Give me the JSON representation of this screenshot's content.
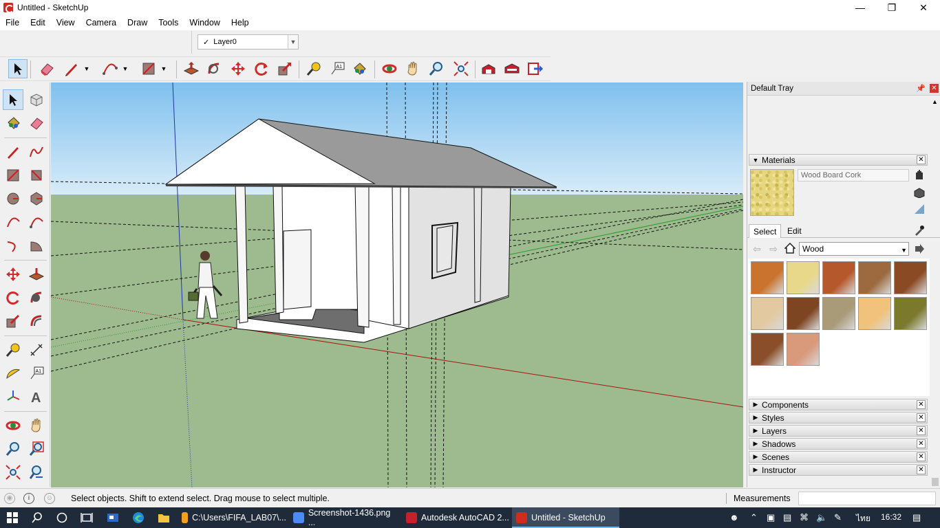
{
  "window": {
    "title": "Untitled - SketchUp"
  },
  "menu": [
    "File",
    "Edit",
    "View",
    "Camera",
    "Draw",
    "Tools",
    "Window",
    "Help"
  ],
  "layer": {
    "current": "Layer0"
  },
  "tray": {
    "title": "Default Tray",
    "materials": {
      "header": "Materials",
      "current_material": "Wood Board Cork",
      "tabs": {
        "select": "Select",
        "edit": "Edit"
      },
      "library": "Wood",
      "swatches": [
        "#c9732e",
        "#e8d98a",
        "#b5582b",
        "#9c6a3e",
        "#8a4a24",
        "#e3c9a0",
        "#7e4522",
        "#a99a78",
        "#f0c27b",
        "#7b7a2c",
        "#8a4f2a",
        "#d99a7c"
      ]
    },
    "panels": [
      "Components",
      "Styles",
      "Layers",
      "Shadows",
      "Scenes",
      "Instructor"
    ]
  },
  "status": {
    "message": "Select objects. Shift to extend select. Drag mouse to select multiple.",
    "measurements_label": "Measurements"
  },
  "taskbar": {
    "apps": [
      {
        "label": "C:\\Users\\FIFA_LAB07\\...",
        "color": "#f0a020"
      },
      {
        "label": "Screenshot-1436.png ...",
        "color": "#4c8bf5"
      },
      {
        "label": "Autodesk AutoCAD 2...",
        "color": "#c8202a"
      },
      {
        "label": "Untitled - SketchUp",
        "color": "#d12a1f"
      }
    ],
    "language": "ไทย",
    "time": "16:32"
  }
}
